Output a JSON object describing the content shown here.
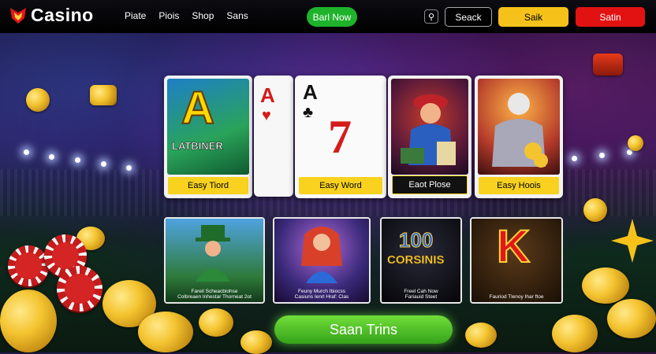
{
  "header": {
    "logo_text": "Casino",
    "nav": [
      "Piate",
      "Piois",
      "Shop",
      "Sans"
    ],
    "start_button": "Barl Now",
    "icon_button": "⚲",
    "search_button": "Seack",
    "sale_button": "Saik",
    "signin_button": "Satin"
  },
  "cards": [
    {
      "label": "Easy Tiord",
      "art_title": "A",
      "art_subtitle": "LATBINER"
    },
    {
      "label": "Easy Word",
      "rank_left": "A",
      "rank_right": "A",
      "big": "7"
    },
    {
      "label": "Eaot Plose"
    },
    {
      "label": "Easy Hoois"
    }
  ],
  "tiles": [
    {
      "caption_1": "Fareil Scheacbiohse",
      "caption_2": "Colbreaen Inhestar Thorneat 2ot"
    },
    {
      "caption_1": "Feuny Murch Ibiocss",
      "caption_2": "Casiuns Ienrl Hraf: Clas"
    },
    {
      "art_title": "100",
      "art_subtitle": "CORSINIS",
      "caption_1": "Freel Cah Now",
      "caption_2": "Fariauid Steet"
    },
    {
      "art_title": "K",
      "caption_1": "Fauriod Tlenoy Ihar ftoe",
      "caption_2": ""
    }
  ],
  "cta": "Saan Trins",
  "colors": {
    "accent_green": "#1fb32b",
    "accent_yellow": "#f6c21a",
    "accent_red": "#e21212"
  }
}
